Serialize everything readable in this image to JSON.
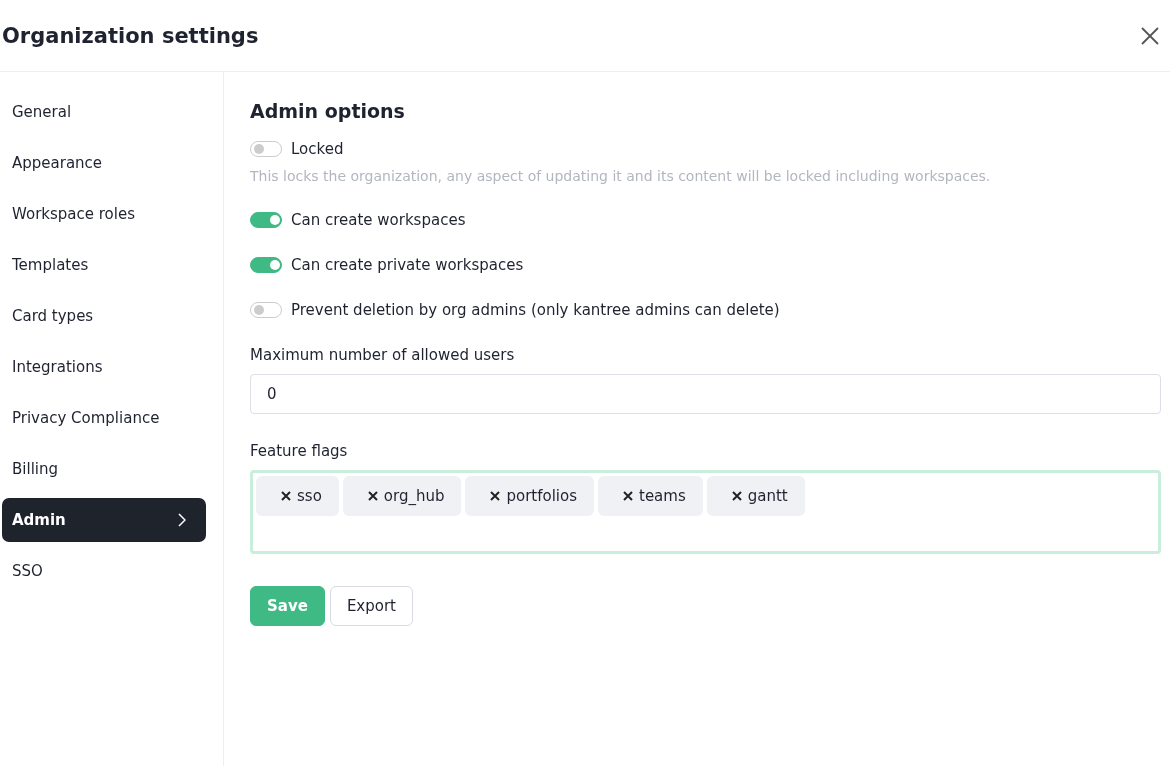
{
  "window": {
    "title": "Organization settings"
  },
  "sidebar": {
    "items": [
      {
        "label": "General",
        "selected": false
      },
      {
        "label": "Appearance",
        "selected": false
      },
      {
        "label": "Workspace roles",
        "selected": false
      },
      {
        "label": "Templates",
        "selected": false
      },
      {
        "label": "Card types",
        "selected": false
      },
      {
        "label": "Integrations",
        "selected": false
      },
      {
        "label": "Privacy Compliance",
        "selected": false
      },
      {
        "label": "Billing",
        "selected": false
      },
      {
        "label": "Admin",
        "selected": true
      },
      {
        "label": "SSO",
        "selected": false
      }
    ]
  },
  "section": {
    "title": "Admin options"
  },
  "toggles": [
    {
      "label": "Locked",
      "on": false,
      "description": "This locks the organization, any aspect of updating it and its content will be locked including workspaces."
    },
    {
      "label": "Can create workspaces",
      "on": true
    },
    {
      "label": "Can create private workspaces",
      "on": true
    },
    {
      "label": "Prevent deletion by org admins (only kantree admins can delete)",
      "on": false
    }
  ],
  "max_users": {
    "label": "Maximum number of allowed users",
    "value": "0"
  },
  "feature_flags": {
    "label": "Feature flags",
    "tags": [
      "sso",
      "org_hub",
      "portfolios",
      "teams",
      "gantt"
    ]
  },
  "buttons": [
    {
      "label": "Save",
      "kind": "primary"
    },
    {
      "label": "Export",
      "kind": "secondary"
    }
  ]
}
